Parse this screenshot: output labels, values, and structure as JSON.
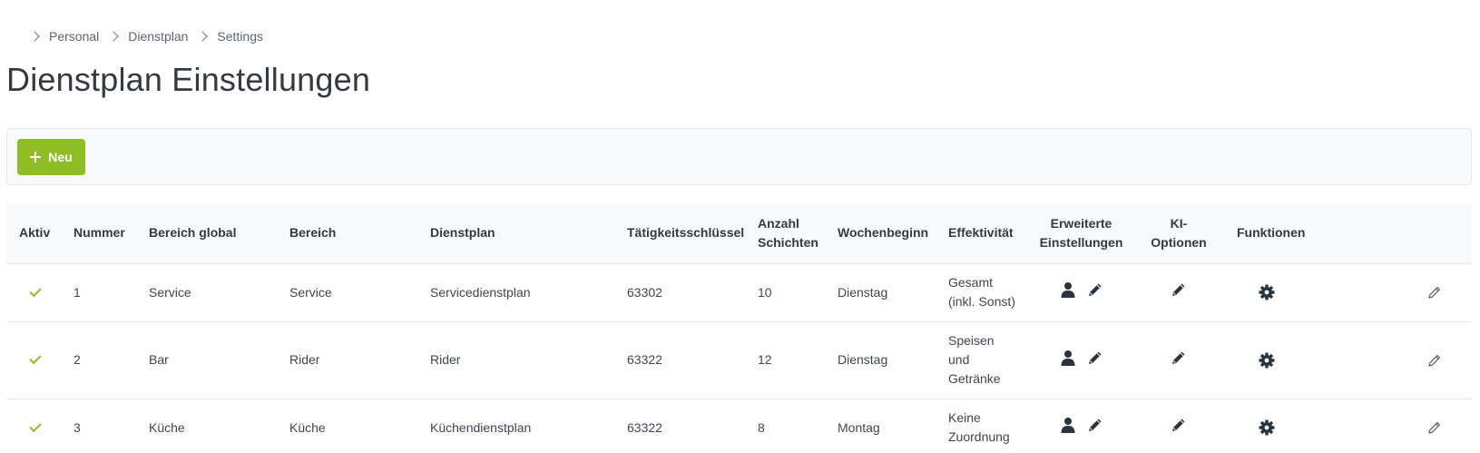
{
  "breadcrumb": {
    "items": [
      "Personal",
      "Dienstplan",
      "Settings"
    ]
  },
  "page": {
    "title": "Dienstplan Einstellungen"
  },
  "toolbar": {
    "new_label": "Neu"
  },
  "table": {
    "headers": {
      "aktiv": "Aktiv",
      "nummer": "Nummer",
      "bereich_global": "Bereich global",
      "bereich": "Bereich",
      "dienstplan": "Dienstplan",
      "taetigkeit": "Tätigkeitsschlüssel",
      "anzahl_1": "Anzahl",
      "anzahl_2": "Schichten",
      "wochenbeginn": "Wochenbeginn",
      "effektivitaet": "Effektivität",
      "erweitert_1": "Erweiterte",
      "erweitert_2": "Einstellungen",
      "ki_1": "KI-",
      "ki_2": "Optionen",
      "funktionen": "Funktionen"
    },
    "rows": [
      {
        "nummer": "1",
        "bereich_global": "Service",
        "bereich": "Service",
        "dienstplan": "Servicedienstplan",
        "taetigkeit": "63302",
        "anzahl": "10",
        "wochenbeginn": "Dienstag",
        "eff_1": "Gesamt",
        "eff_2": "(inkl. Sonst)",
        "eff_3": ""
      },
      {
        "nummer": "2",
        "bereich_global": "Bar",
        "bereich": "Rider",
        "dienstplan": "Rider",
        "taetigkeit": "63322",
        "anzahl": "12",
        "wochenbeginn": "Dienstag",
        "eff_1": "Speisen",
        "eff_2": "und",
        "eff_3": "Getränke"
      },
      {
        "nummer": "3",
        "bereich_global": "Küche",
        "bereich": "Küche",
        "dienstplan": "Küchendienstplan",
        "taetigkeit": "63322",
        "anzahl": "8",
        "wochenbeginn": "Montag",
        "eff_1": "Keine",
        "eff_2": "Zuordnung",
        "eff_3": ""
      }
    ]
  },
  "colors": {
    "accent": "#8fbd24",
    "icon": "#2b3240",
    "text": "#343a40"
  },
  "icons": {
    "active": "check-icon",
    "user": "user-icon",
    "edit": "pencil-icon",
    "settings": "gear-icon",
    "row_edit": "pencil-outline-icon"
  }
}
